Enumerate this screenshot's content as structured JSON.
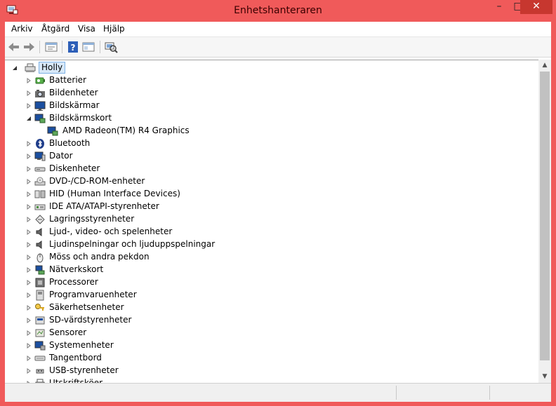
{
  "window": {
    "title": "Enhetshanteraren",
    "minimize_glyph": "–",
    "maximize_glyph": "□",
    "close_glyph": "✕"
  },
  "menu": [
    "Arkiv",
    "Åtgärd",
    "Visa",
    "Hjälp"
  ],
  "toolbar_icons": [
    "back-arrow-icon",
    "forward-arrow-icon",
    "properties-icon",
    "help-icon",
    "show-hide-console-tree-icon",
    "scan-hardware-icon"
  ],
  "tree": {
    "root": {
      "label": "Holly",
      "icon": "computer-icon",
      "expanded": true,
      "selected": true
    },
    "items": [
      {
        "label": "Batterier",
        "icon": "battery-icon",
        "expanded": false
      },
      {
        "label": "Bildenheter",
        "icon": "camera-icon",
        "expanded": false
      },
      {
        "label": "Bildskärmar",
        "icon": "monitor-icon",
        "expanded": false
      },
      {
        "label": "Bildskärmskort",
        "icon": "display-adapter-icon",
        "expanded": true
      },
      {
        "label": "AMD Radeon(TM) R4 Graphics",
        "icon": "display-adapter-icon",
        "child": true
      },
      {
        "label": "Bluetooth",
        "icon": "bluetooth-icon",
        "expanded": false
      },
      {
        "label": "Dator",
        "icon": "computer-icon",
        "expanded": false
      },
      {
        "label": "Diskenheter",
        "icon": "disk-drive-icon",
        "expanded": false
      },
      {
        "label": "DVD-/CD-ROM-enheter",
        "icon": "dvd-drive-icon",
        "expanded": false
      },
      {
        "label": "HID (Human Interface Devices)",
        "icon": "hid-icon",
        "expanded": false
      },
      {
        "label": "IDE ATA/ATAPI-styrenheter",
        "icon": "ide-controller-icon",
        "expanded": false
      },
      {
        "label": "Lagringsstyrenheter",
        "icon": "storage-controller-icon",
        "expanded": false
      },
      {
        "label": "Ljud-, video- och spelenheter",
        "icon": "speaker-icon",
        "expanded": false
      },
      {
        "label": "Ljudinspelningar och ljuduppspelningar",
        "icon": "speaker-icon",
        "expanded": false
      },
      {
        "label": "Möss och andra pekdon",
        "icon": "mouse-icon",
        "expanded": false
      },
      {
        "label": "Nätverkskort",
        "icon": "network-adapter-icon",
        "expanded": false
      },
      {
        "label": "Processorer",
        "icon": "processor-icon",
        "expanded": false
      },
      {
        "label": "Programvaruenheter",
        "icon": "software-device-icon",
        "expanded": false
      },
      {
        "label": "Säkerhetsenheter",
        "icon": "security-key-icon",
        "expanded": false
      },
      {
        "label": "SD-värdstyrenheter",
        "icon": "sd-host-icon",
        "expanded": false
      },
      {
        "label": "Sensorer",
        "icon": "sensor-icon",
        "expanded": false
      },
      {
        "label": "Systemenheter",
        "icon": "system-device-icon",
        "expanded": false
      },
      {
        "label": "Tangentbord",
        "icon": "keyboard-icon",
        "expanded": false
      },
      {
        "label": "USB-styrenheter",
        "icon": "usb-icon",
        "expanded": false
      },
      {
        "label": "Utskriftsköer",
        "icon": "printer-icon",
        "expanded": false
      }
    ]
  },
  "colors": {
    "title_bar": "#f05a5a",
    "close_button": "#c7372f",
    "selection": "#d7e8f8"
  }
}
